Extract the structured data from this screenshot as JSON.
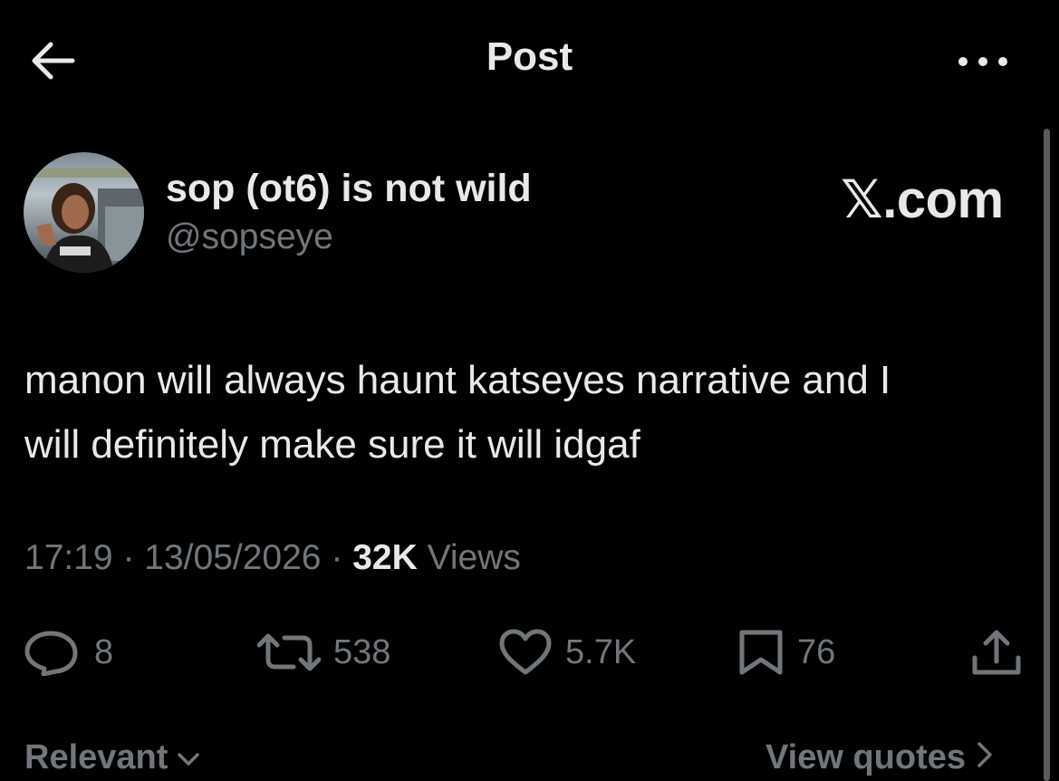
{
  "header": {
    "title": "Post",
    "back_icon": "arrow-left-icon",
    "more_icon": "more-horizontal-icon"
  },
  "post": {
    "author": {
      "display_name": "sop (ot6) is not wild",
      "handle": "@sopseye"
    },
    "watermark": "𝕏.com",
    "text_lines": [
      "manon will always haunt katseyes narrative and I",
      "will definitely make sure it will idgaf"
    ],
    "meta": {
      "time": "17:19",
      "separator": "·",
      "date": "13/05/2026",
      "views_count": "32K",
      "views_label": "Views"
    },
    "actions": {
      "replies": "8",
      "reposts": "538",
      "likes": "5.7K",
      "bookmarks": "76"
    }
  },
  "footer": {
    "sort_label": "Relevant",
    "quotes_link": "View quotes"
  },
  "colors": {
    "background": "#000000",
    "primary_text": "#e7e9ea",
    "secondary_text": "#71767b"
  }
}
